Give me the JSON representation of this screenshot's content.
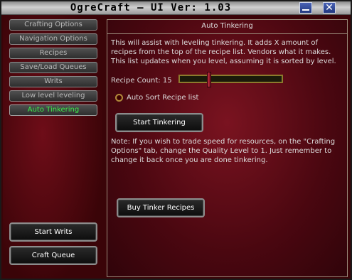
{
  "window": {
    "title": "OgreCraft  — UI Ver: 1.03",
    "close_glyph": "✕"
  },
  "sidebar": {
    "items": [
      {
        "label": "Crafting Options"
      },
      {
        "label": "Navigation Options"
      },
      {
        "label": "Recipes"
      },
      {
        "label": "Save/Load Queues"
      },
      {
        "label": "Writs"
      },
      {
        "label": "Low level leveling"
      },
      {
        "label": "Auto Tinkering",
        "active": true
      }
    ],
    "start_writs": "Start Writs",
    "craft_queue": "Craft Queue"
  },
  "panel": {
    "title": "Auto Tinkering",
    "description": "This will assist with leveling tinkering. It adds X amount of recipes from the top of the recipe list. Vendors what it makes. This list updates when you level, assuming it is sorted by level.",
    "recipe_count_label": "Recipe Count: 15",
    "recipe_count_value": 15,
    "slider_fraction": 0.28,
    "auto_sort_label": "Auto Sort Recipe list",
    "auto_sort_checked": false,
    "start_tinkering": "Start Tinkering",
    "note": "Note: If you wish to trade speed for resources, on the \"Crafting Options\" tab, change the Quality Level to 1. Just remember to change it back once you are done tinkering.",
    "buy_tinker_recipes": "Buy Tinker Recipes"
  },
  "colors": {
    "active_tab": "#3cf04a",
    "background": "#3a0408",
    "slider_frame": "#8c7a2c"
  }
}
